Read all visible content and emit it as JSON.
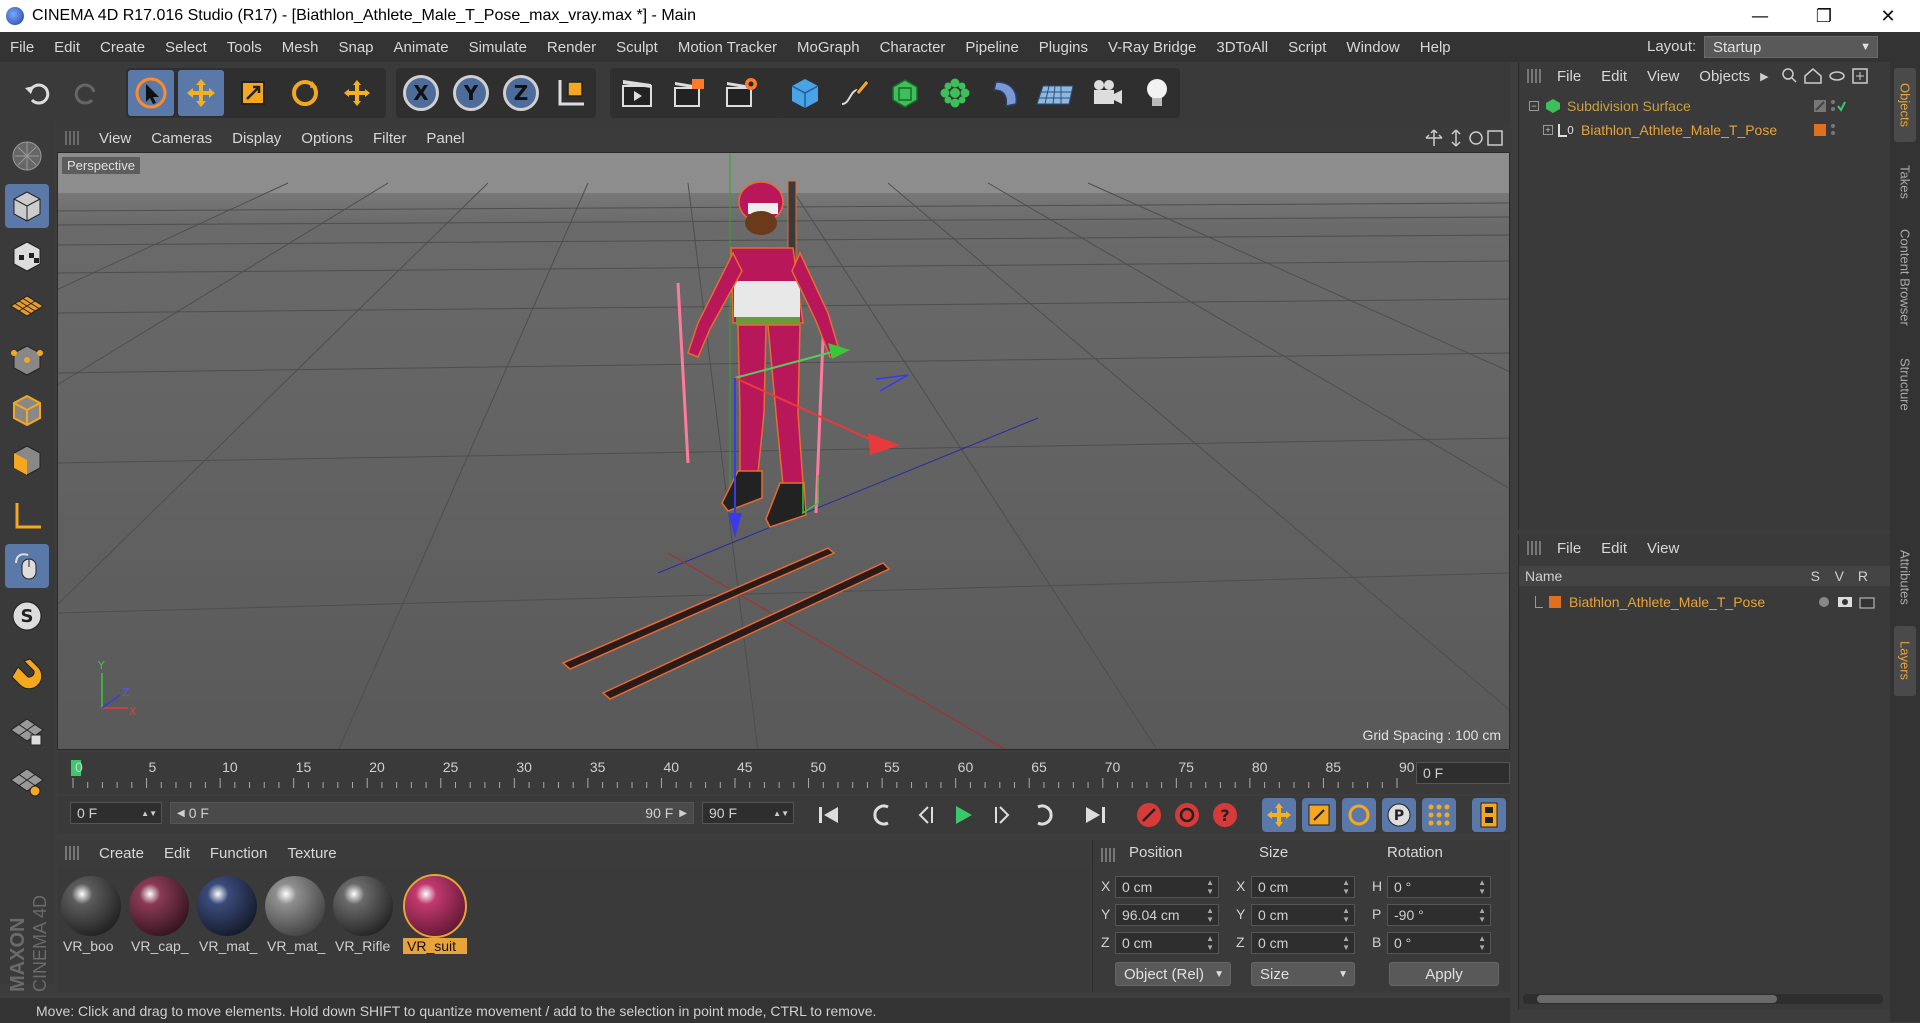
{
  "window": {
    "title": "CINEMA 4D R17.016 Studio (R17) - [Biathlon_Athlete_Male_T_Pose_max_vray.max *] - Main"
  },
  "menubar": {
    "items": [
      "File",
      "Edit",
      "Create",
      "Select",
      "Tools",
      "Mesh",
      "Snap",
      "Animate",
      "Simulate",
      "Render",
      "Sculpt",
      "Motion Tracker",
      "MoGraph",
      "Character",
      "Pipeline",
      "Plugins",
      "V-Ray Bridge",
      "3DToAll",
      "Script",
      "Window",
      "Help"
    ],
    "layout_label": "Layout:",
    "layout_value": "Startup"
  },
  "toolbar": {
    "undo_icon": "undo-icon",
    "redo_icon": "redo-icon",
    "axes": [
      "X",
      "Y",
      "Z"
    ]
  },
  "viewport": {
    "menu": [
      "View",
      "Cameras",
      "Display",
      "Options",
      "Filter",
      "Panel"
    ],
    "label": "Perspective",
    "grid_spacing": "Grid Spacing : 100 cm",
    "axis_labels": [
      "Y",
      "Z",
      "X"
    ]
  },
  "timeline": {
    "ticks": [
      "0",
      "5",
      "10",
      "15",
      "20",
      "25",
      "30",
      "35",
      "40",
      "45",
      "50",
      "55",
      "60",
      "65",
      "70",
      "75",
      "80",
      "85",
      "90"
    ],
    "current_frame": "0 F"
  },
  "transport": {
    "start_frame": "0 F",
    "range_start": "0 F",
    "range_end": "90 F",
    "end_frame": "90 F"
  },
  "materials": {
    "menu": [
      "Create",
      "Edit",
      "Function",
      "Texture"
    ],
    "items": [
      {
        "label": "VR_boo",
        "color_a": "#5c5c5c",
        "color_b": "#1a1a1a"
      },
      {
        "label": "VR_cap_",
        "color_a": "#8a3a55",
        "color_b": "#2a1018"
      },
      {
        "label": "VR_mat_",
        "color_a": "#3b4a7a",
        "color_b": "#101522"
      },
      {
        "label": "VR_mat_",
        "color_a": "#8f8f8f",
        "color_b": "#3a3a3a"
      },
      {
        "label": "VR_Rifle",
        "color_a": "#6a6a6a",
        "color_b": "#1c1c1c"
      },
      {
        "label": "VR_suit",
        "color_a": "#c0396e",
        "color_b": "#5a1530"
      }
    ],
    "selected_index": 5
  },
  "coordinates": {
    "headers": [
      "Position",
      "Size",
      "Rotation"
    ],
    "position": [
      {
        "axis": "X",
        "value": "0 cm"
      },
      {
        "axis": "Y",
        "value": "96.04 cm"
      },
      {
        "axis": "Z",
        "value": "0 cm"
      }
    ],
    "size": [
      {
        "axis": "X",
        "value": "0 cm"
      },
      {
        "axis": "Y",
        "value": "0 cm"
      },
      {
        "axis": "Z",
        "value": "0 cm"
      }
    ],
    "rotation": [
      {
        "axis": "H",
        "value": "0 °"
      },
      {
        "axis": "P",
        "value": "-90 °"
      },
      {
        "axis": "B",
        "value": "0 °"
      }
    ],
    "mode": "Object (Rel)",
    "size_mode": "Size",
    "apply": "Apply"
  },
  "objects_panel": {
    "menu": [
      "File",
      "Edit",
      "View",
      "Objects"
    ],
    "items": [
      {
        "name": "Subdivision Surface",
        "color": "#c8a040"
      },
      {
        "name": "Biathlon_Athlete_Male_T_Pose",
        "color": "#e8a33a"
      }
    ]
  },
  "layers_panel": {
    "menu": [
      "File",
      "Edit",
      "View"
    ],
    "columns": [
      "Name",
      "S",
      "V",
      "R"
    ],
    "items": [
      {
        "name": "Biathlon_Athlete_Male_T_Pose",
        "color": "#e07020"
      }
    ]
  },
  "side_tabs": [
    "Objects",
    "Takes",
    "Content Browser",
    "Structure",
    "Attributes",
    "Layers"
  ],
  "status": "Move: Click and drag to move elements. Hold down SHIFT to quantize movement / add to the selection in point mode, CTRL to remove.",
  "logo": "MAXON CINEMA 4D",
  "colors": {
    "accent_blue": "#5a79a8",
    "selection_orange": "#e8a33a",
    "viewport_bg": "#5b5b5b"
  }
}
